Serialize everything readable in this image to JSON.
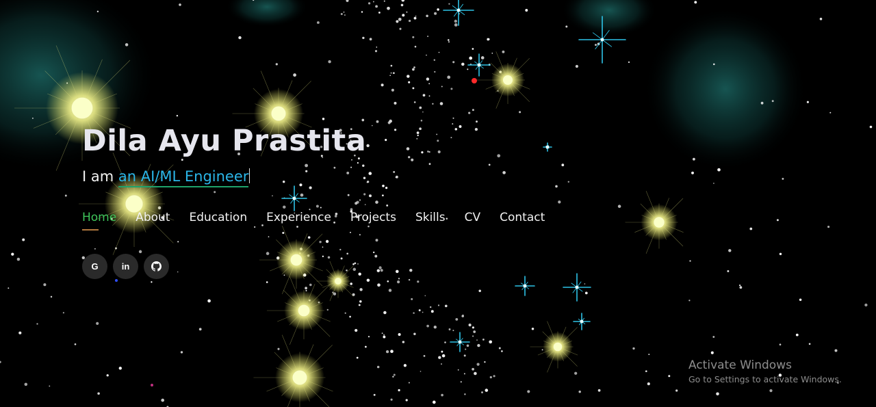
{
  "hero": {
    "name": "Dila Ayu Prastita",
    "intro": "I am",
    "role": "an AI/ML Engineer"
  },
  "nav": {
    "items": [
      {
        "label": "Home",
        "active": true
      },
      {
        "label": "About"
      },
      {
        "label": "Education"
      },
      {
        "label": "Experience"
      },
      {
        "label": "Projects"
      },
      {
        "label": "Skills"
      },
      {
        "label": "CV"
      },
      {
        "label": "Contact"
      }
    ]
  },
  "socials": [
    {
      "icon": "google-icon",
      "glyph": "G"
    },
    {
      "icon": "linkedin-icon",
      "glyph": "in"
    },
    {
      "icon": "github-icon",
      "glyph": ""
    }
  ],
  "watermark": {
    "title": "Activate Windows",
    "subtitle": "Go to Settings to activate Windows."
  },
  "colors": {
    "background": "#000000",
    "accent_active": "#3ec45a",
    "role_text": "#2bb6e8",
    "role_underline": "#1ea36b",
    "social_bg": "#2a2a2a"
  }
}
